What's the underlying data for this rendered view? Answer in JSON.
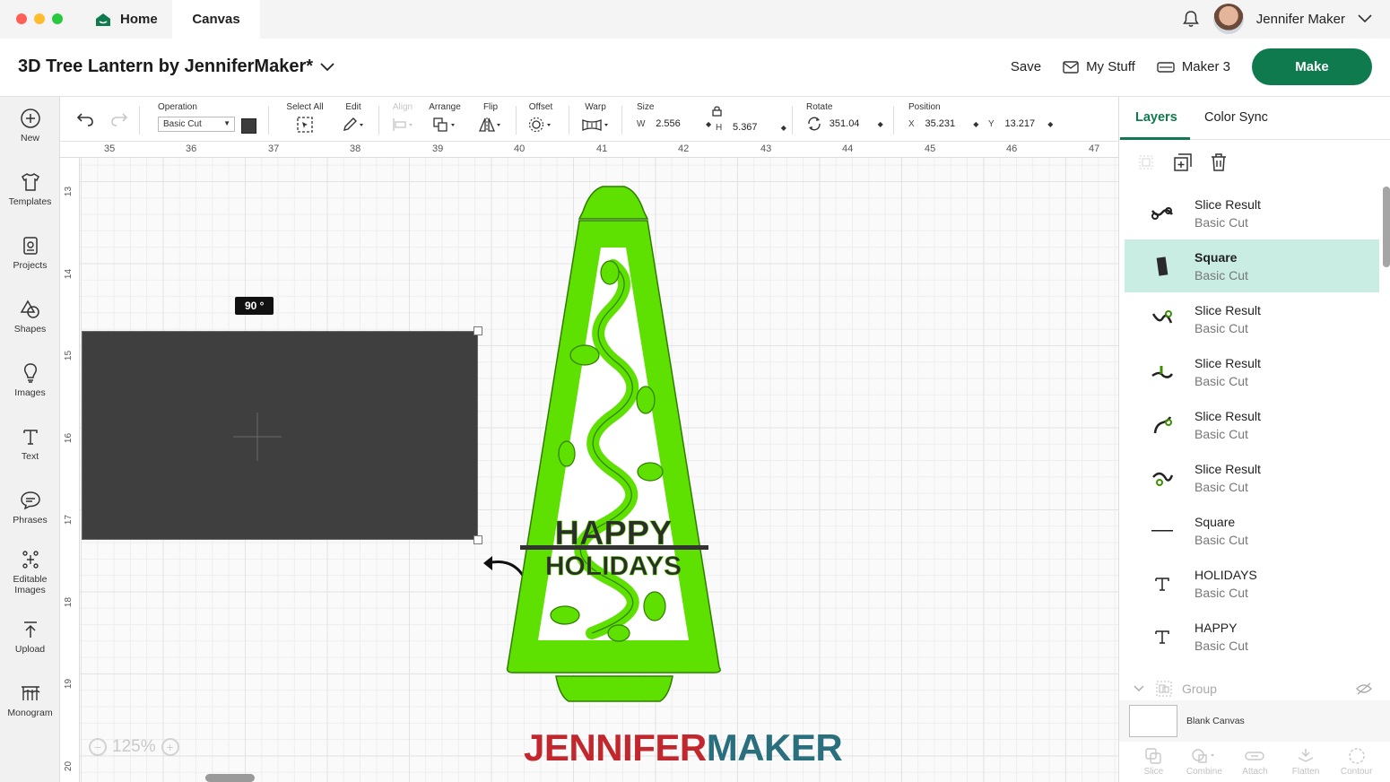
{
  "window": {
    "tabs": [
      {
        "label": "Home"
      },
      {
        "label": "Canvas"
      }
    ],
    "user_name": "Jennifer Maker"
  },
  "header": {
    "project_title": "3D Tree Lantern by JenniferMaker*",
    "save_label": "Save",
    "my_stuff_label": "My Stuff",
    "machine_label": "Maker 3",
    "make_label": "Make",
    "make_color": "#0f7a4e"
  },
  "sidebar": {
    "items": [
      {
        "label": "New",
        "icon": "plus-circle-icon"
      },
      {
        "label": "Templates",
        "icon": "shirt-icon"
      },
      {
        "label": "Projects",
        "icon": "projects-icon"
      },
      {
        "label": "Shapes",
        "icon": "shapes-icon"
      },
      {
        "label": "Images",
        "icon": "lightbulb-icon"
      },
      {
        "label": "Text",
        "icon": "text-icon"
      },
      {
        "label": "Phrases",
        "icon": "speech-bubble-icon"
      },
      {
        "label": "Editable Images",
        "icon": "editable-images-icon"
      },
      {
        "label": "Upload",
        "icon": "upload-icon"
      },
      {
        "label": "Monogram",
        "icon": "monogram-icon"
      }
    ]
  },
  "toolbar": {
    "operation_label": "Operation",
    "operation_value": "Basic Cut",
    "select_all_label": "Select All",
    "edit_label": "Edit",
    "align_label": "Align",
    "arrange_label": "Arrange",
    "flip_label": "Flip",
    "offset_label": "Offset",
    "warp_label": "Warp",
    "size_label": "Size",
    "w_label": "W",
    "w_value": "2.556",
    "h_label": "H",
    "h_value": "5.367",
    "rotate_label": "Rotate",
    "rotate_value": "351.04",
    "position_label": "Position",
    "x_label": "X",
    "x_value": "35.231",
    "y_label": "Y",
    "y_value": "13.217"
  },
  "canvas": {
    "ruler_top": [
      "35",
      "36",
      "37",
      "38",
      "39",
      "40",
      "41",
      "42",
      "43",
      "44",
      "45",
      "46",
      "47"
    ],
    "ruler_left": [
      "13",
      "14",
      "15",
      "16",
      "17",
      "18",
      "19",
      "20"
    ],
    "rotation_badge": "90 °",
    "zoom_level": "125%",
    "happy_text": "HAPPY",
    "holidays_text": "HOLIDAYS",
    "logo_part1": "JENNIFER",
    "logo_part2": "MAKER",
    "lantern_color": "#5ee000",
    "rect_color": "#3f3f3f"
  },
  "right_panel": {
    "tabs": [
      {
        "label": "Layers"
      },
      {
        "label": "Color Sync"
      }
    ],
    "layers": [
      {
        "name": "Slice Result",
        "op": "Basic Cut",
        "thumb": "slice-result-icon"
      },
      {
        "name": "Square",
        "op": "Basic Cut",
        "thumb": "square-icon",
        "selected": true
      },
      {
        "name": "Slice Result",
        "op": "Basic Cut",
        "thumb": "slice-result-icon"
      },
      {
        "name": "Slice Result",
        "op": "Basic Cut",
        "thumb": "slice-result-icon"
      },
      {
        "name": "Slice Result",
        "op": "Basic Cut",
        "thumb": "slice-result-icon"
      },
      {
        "name": "Slice Result",
        "op": "Basic Cut",
        "thumb": "slice-result-icon"
      },
      {
        "name": "Square",
        "op": "Basic Cut",
        "thumb": "line-icon"
      },
      {
        "name": "HOLIDAYS",
        "op": "Basic Cut",
        "thumb": "text-icon"
      },
      {
        "name": "HAPPY",
        "op": "Basic Cut",
        "thumb": "text-icon"
      }
    ],
    "group_label": "Group",
    "blank_canvas_label": "Blank Canvas",
    "bottom_tools": [
      "Slice",
      "Combine",
      "Attach",
      "Flatten",
      "Contour"
    ]
  }
}
